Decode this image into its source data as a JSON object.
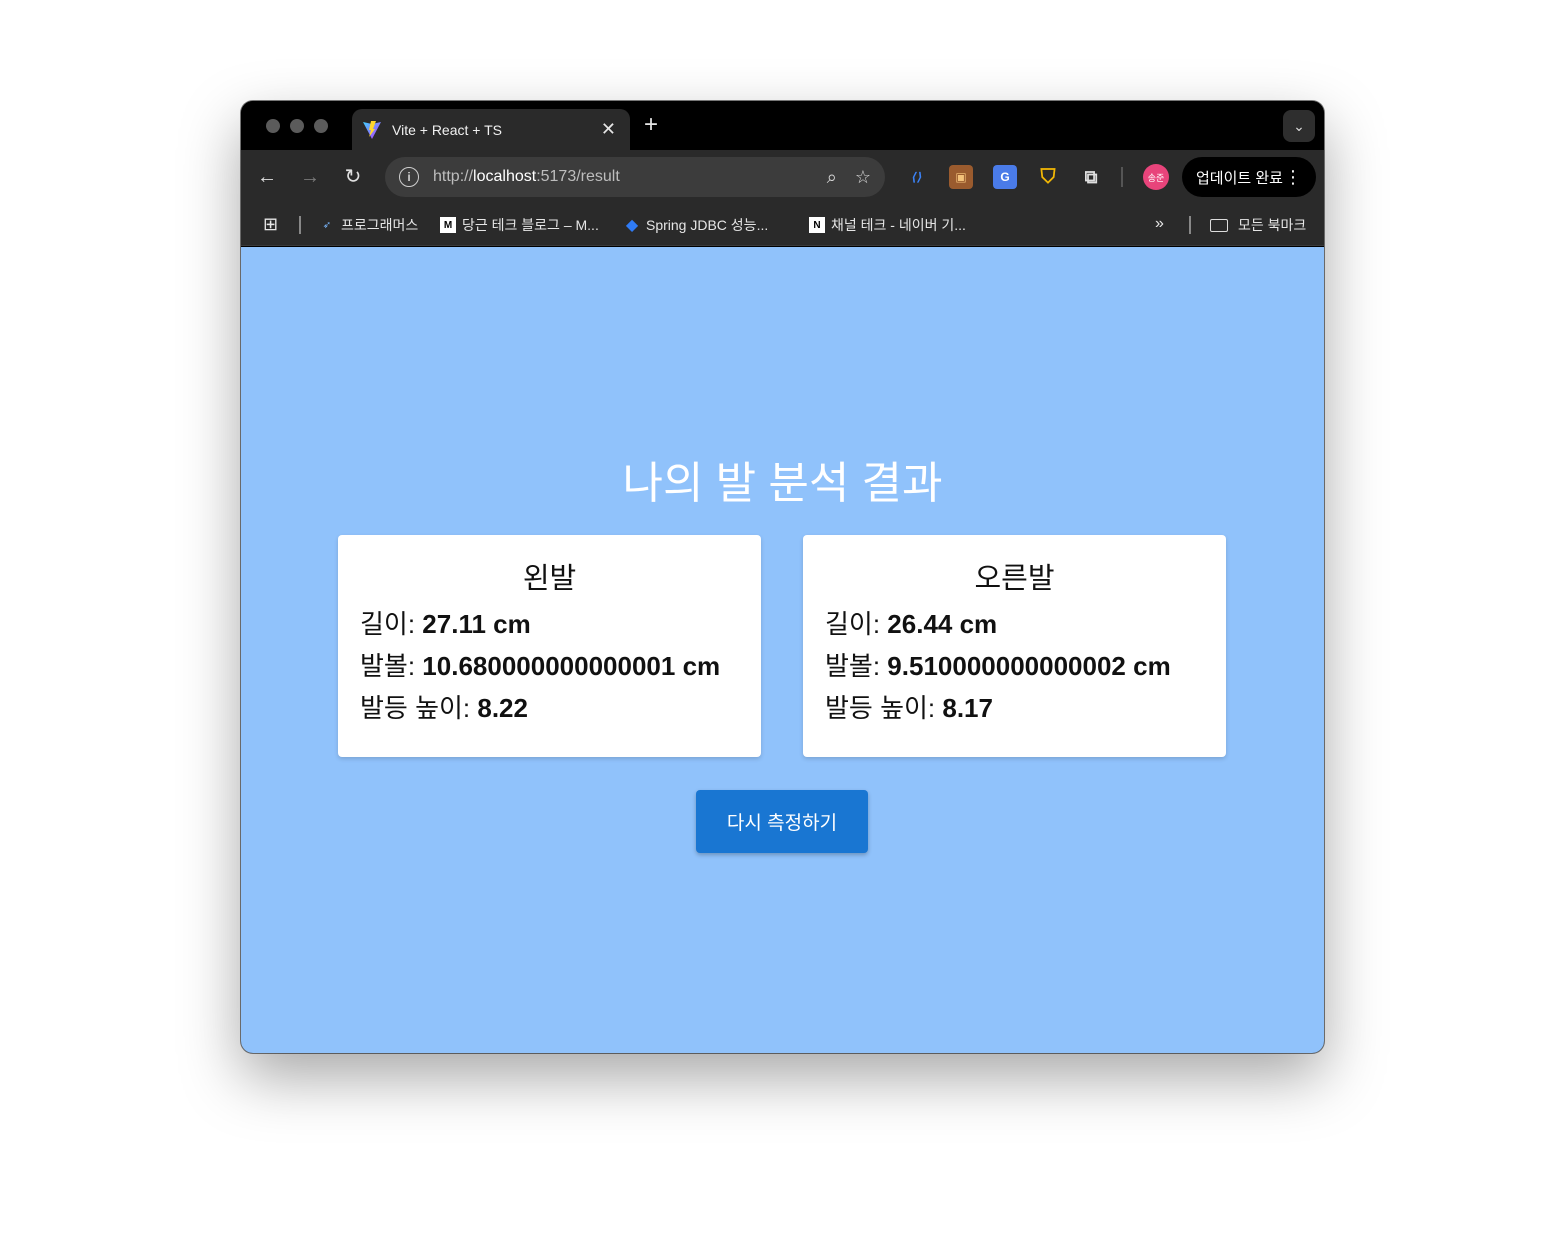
{
  "browser": {
    "tab": {
      "title": "Vite + React + TS",
      "favicon": "vite-logo-icon",
      "close": "✕"
    },
    "new_tab": "+",
    "address": {
      "scheme": "http://",
      "host": "localhost",
      "rest": ":5173/result"
    },
    "profile_initials": "송준",
    "update_label": "업데이트 완료",
    "bookmarks": [
      {
        "label": "프로그래머스",
        "icon": "programmers-icon"
      },
      {
        "label": "당근 테크 블로그 – M...",
        "icon": "medium-icon"
      },
      {
        "label": "Spring JDBC 성능...",
        "icon": "cube-icon"
      },
      {
        "label": "채널 테크 - 네이버 기...",
        "icon": "notion-icon"
      }
    ],
    "all_bookmarks": "모든 북마크"
  },
  "page": {
    "title": "나의 발 분석 결과",
    "left": {
      "title": "왼발",
      "length_label": "길이: ",
      "length_value": "27.11 cm",
      "width_label": "발볼: ",
      "width_value": "10.680000000000001 cm",
      "height_label": "발등 높이: ",
      "height_value": "8.22"
    },
    "right": {
      "title": "오른발",
      "length_label": "길이: ",
      "length_value": "26.44 cm",
      "width_label": "발볼: ",
      "width_value": "9.510000000000002 cm",
      "height_label": "발등 높이: ",
      "height_value": "8.17"
    },
    "button_label": "다시 측정하기"
  },
  "colors": {
    "page_bg": "#90c2fb",
    "button": "#1976d2",
    "chrome": "#2a2a2a"
  }
}
